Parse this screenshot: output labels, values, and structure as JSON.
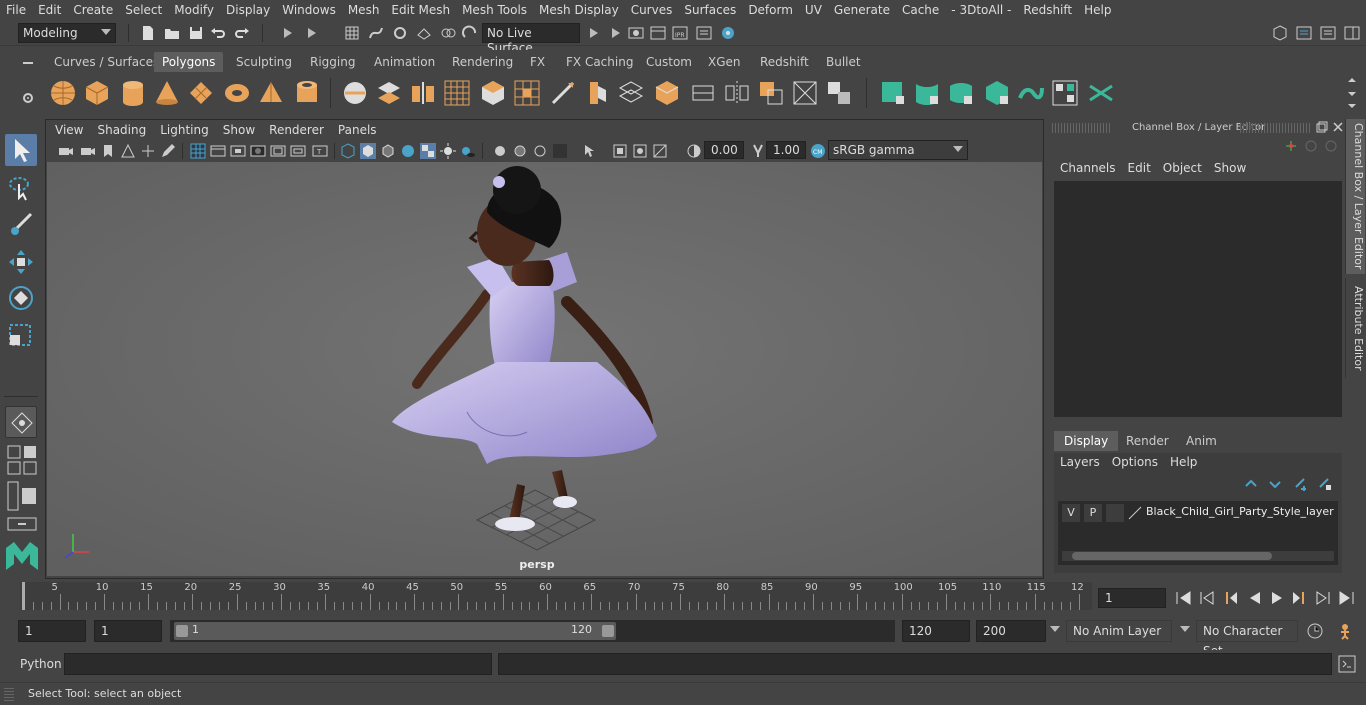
{
  "menubar": [
    "File",
    "Edit",
    "Create",
    "Select",
    "Modify",
    "Display",
    "Windows",
    "Mesh",
    "Edit Mesh",
    "Mesh Tools",
    "Mesh Display",
    "Curves",
    "Surfaces",
    "Deform",
    "UV",
    "Generate",
    "Cache",
    "- 3DtoAll -",
    "Redshift",
    "Help"
  ],
  "status": {
    "workspace": "Modeling",
    "live_surface": "No Live Surface"
  },
  "shelf_tabs": [
    "Curves / Surfaces",
    "Polygons",
    "Sculpting",
    "Rigging",
    "Animation",
    "Rendering",
    "FX",
    "FX Caching",
    "Custom",
    "XGen",
    "Redshift",
    "Bullet"
  ],
  "shelf_active": "Polygons",
  "viewport": {
    "menu": [
      "View",
      "Shading",
      "Lighting",
      "Show",
      "Renderer",
      "Panels"
    ],
    "exposure": "0.00",
    "gamma": "1.00",
    "colorspace": "sRGB gamma",
    "camera_label": "persp"
  },
  "channel_box": {
    "title": "Channel Box / Layer Editor",
    "menu": [
      "Channels",
      "Edit",
      "Object",
      "Show"
    ],
    "tabs": [
      "Display",
      "Render",
      "Anim"
    ],
    "active_tab": "Display",
    "layer_menu": [
      "Layers",
      "Options",
      "Help"
    ],
    "layer": {
      "v": "V",
      "p": "P",
      "name": "Black_Child_Girl_Party_Style_layer"
    }
  },
  "side_tabs": [
    "Channel Box / Layer Editor",
    "Attribute Editor"
  ],
  "timeline": {
    "ticks": [
      "5",
      "10",
      "15",
      "20",
      "25",
      "30",
      "35",
      "40",
      "45",
      "50",
      "55",
      "60",
      "65",
      "70",
      "75",
      "80",
      "85",
      "90",
      "95",
      "100",
      "105",
      "110",
      "115",
      "12"
    ],
    "first_frame": "1",
    "current_frame": "1"
  },
  "range": {
    "start": "1",
    "playback_start": "1",
    "slider_start": "1",
    "slider_end": "120",
    "playback_end": "120",
    "end": "200",
    "anim_layer": "No Anim Layer",
    "character_set": "No Character Set"
  },
  "cmdline": {
    "label": "Python"
  },
  "helpline": "Select Tool: select an object",
  "colors": {
    "accent": "#e8a35a",
    "teal": "#3bb89a",
    "active_tab": "#5d5d5d"
  }
}
